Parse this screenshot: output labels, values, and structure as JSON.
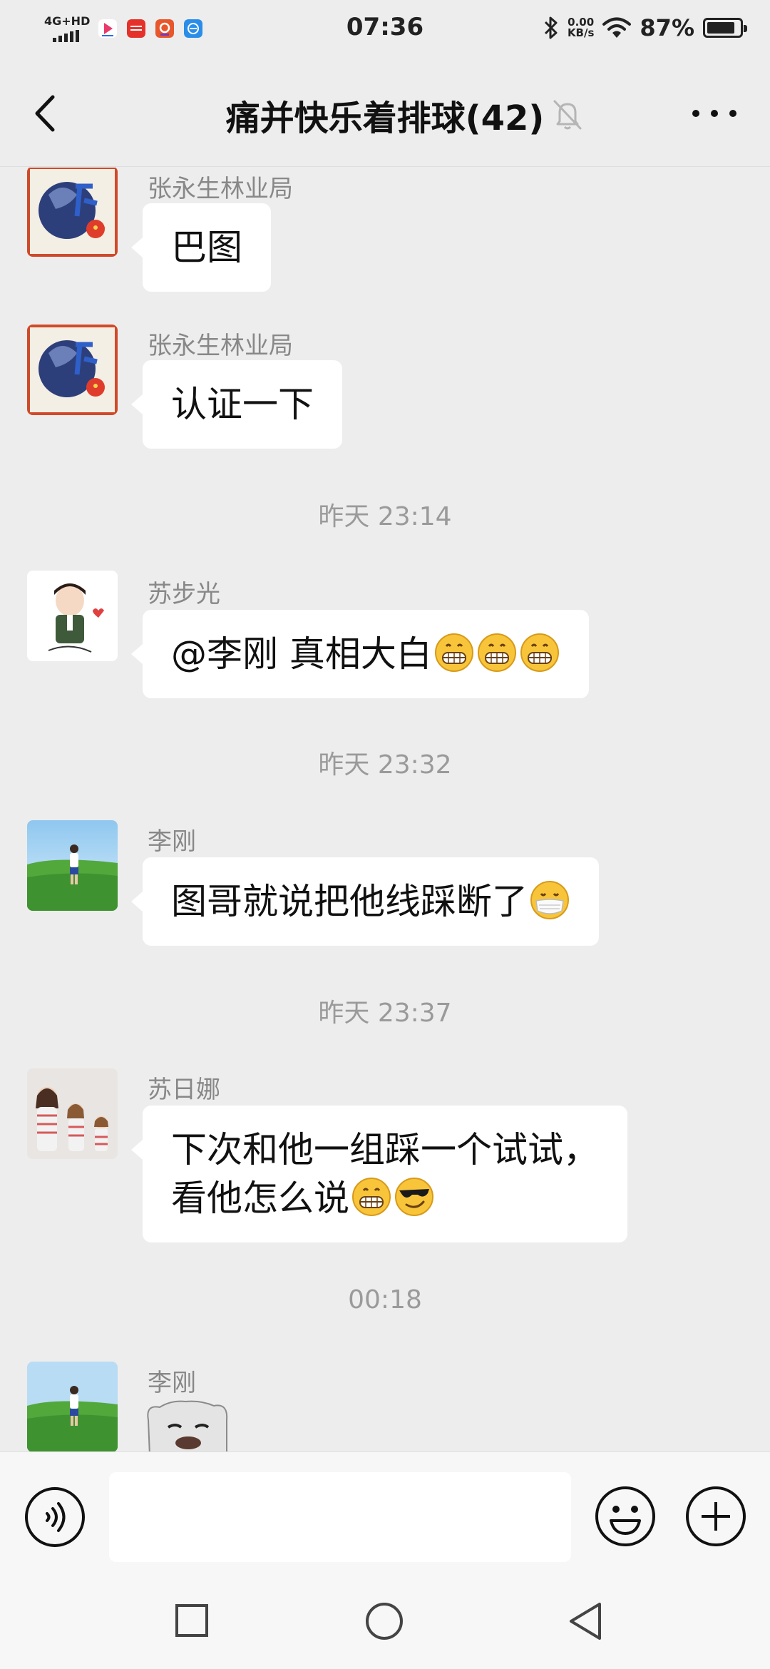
{
  "status_bar": {
    "network": "4G+HD",
    "time": "07:36",
    "speed_value": "0.00",
    "speed_unit": "KB/s",
    "battery_percent": "87%",
    "battery_level": 0.87
  },
  "header": {
    "title": "痛并快乐着排球(42)"
  },
  "messages": [
    {
      "sender": "张永生林业局",
      "text": "巴图"
    },
    {
      "sender": "张永生林业局",
      "text": "认证一下"
    },
    {
      "timestamp": "昨天 23:14"
    },
    {
      "sender": "苏步光",
      "text": "@李刚  真相大白"
    },
    {
      "timestamp": "昨天 23:32"
    },
    {
      "sender": "李刚",
      "text": "图哥就说把他线踩断了"
    },
    {
      "timestamp": "昨天 23:37"
    },
    {
      "sender": "苏日娜",
      "text_line1": "下次和他一组踩一个试试，",
      "text_line2": "看他怎么说"
    },
    {
      "timestamp": "00:18"
    },
    {
      "sender": "李刚"
    }
  ],
  "emoji_names": [
    "grin-emoji",
    "mask-emoji",
    "sunglasses-emoji"
  ],
  "colors": {
    "background": "#ededed",
    "bubble": "#ffffff",
    "meta_text": "#9a9a9a"
  }
}
